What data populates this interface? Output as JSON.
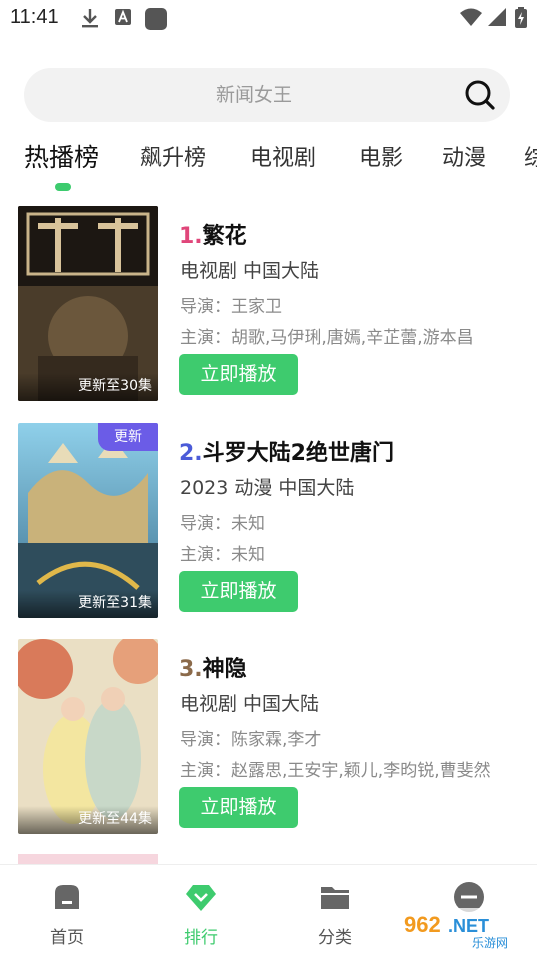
{
  "status_bar": {
    "time": "11:41",
    "left_icons": [
      "download-icon",
      "font-a-icon",
      "app-square-icon"
    ],
    "right_icons": [
      "wifi-icon",
      "signal-icon",
      "battery-charging-icon"
    ]
  },
  "search": {
    "placeholder": "新闻女王",
    "icon": "search-icon"
  },
  "tabs": [
    {
      "label": "热播榜",
      "active": true
    },
    {
      "label": "飙升榜",
      "active": false
    },
    {
      "label": "电视剧",
      "active": false
    },
    {
      "label": "电影",
      "active": false
    },
    {
      "label": "动漫",
      "active": false
    },
    {
      "label": "综",
      "active": false
    }
  ],
  "colors": {
    "accent": "#3ecb6e",
    "rank1": "#e0467a",
    "rank2": "#4b5bd8",
    "rank3": "#8b6a4a",
    "new_badge": "#6b5ce7"
  },
  "items": [
    {
      "rank": "1.",
      "title": "繁花",
      "meta": " 电视剧  中国大陆",
      "director": "导演：王家卫",
      "cast": "主演：胡歌,马伊琍,唐嫣,辛芷蕾,游本昌",
      "update": "更新至30集",
      "badge": "",
      "play_label": "立即播放"
    },
    {
      "rank": "2.",
      "title": "斗罗大陆2绝世唐门",
      "meta": "2023  动漫  中国大陆",
      "director": "导演：未知",
      "cast": "主演：未知",
      "update": "更新至31集",
      "badge": "更新",
      "play_label": "立即播放"
    },
    {
      "rank": "3.",
      "title": "神隐",
      "meta": " 电视剧  中国大陆",
      "director": "导演：陈家霖,李才",
      "cast": "主演：赵露思,王安宇,颖儿,李昀锐,曹斐然",
      "update": "更新至44集",
      "badge": "",
      "play_label": "立即播放"
    }
  ],
  "bottom_nav": [
    {
      "label": "首页",
      "icon": "home-icon",
      "active": false
    },
    {
      "label": "排行",
      "icon": "diamond-rank-icon",
      "active": true
    },
    {
      "label": "分类",
      "icon": "folder-icon",
      "active": false
    },
    {
      "label": "",
      "icon": "profile-icon",
      "active": false
    }
  ],
  "watermark": {
    "text": "962.NET",
    "subtext": "乐游网"
  }
}
